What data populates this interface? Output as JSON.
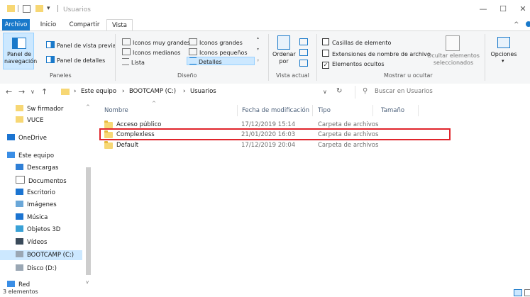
{
  "window": {
    "title": "Usuarios",
    "controls": {
      "minimize": "—",
      "maximize": "☐",
      "close": "✕"
    }
  },
  "ribbon_tabs": {
    "archivo": "Archivo",
    "inicio": "Inicio",
    "compartir": "Compartir",
    "vista": "Vista"
  },
  "ribbon": {
    "panel_navegacion": "Panel de\nnavegación",
    "panel_vista_previa": "Panel de vista previa",
    "panel_detalles": "Panel de detalles",
    "group_paneles": "Paneles",
    "layout": {
      "iconos_muy_grandes": "Iconos muy grandes",
      "iconos_grandes": "Iconos grandes",
      "iconos_medianos": "Iconos medianos",
      "iconos_pequenos": "Iconos pequeños",
      "lista": "Lista",
      "detalles": "Detalles"
    },
    "group_diseno": "Diseño",
    "ordenar": "Ordenar\npor",
    "group_vista_actual": "Vista actual",
    "casillas": "Casillas de elemento",
    "extensiones": "Extensiones de nombre de archivo",
    "ocultos": "Elementos ocultos",
    "ocultar": "Ocultar elementos\nseleccionados",
    "group_mostrar": "Mostrar u ocultar",
    "opciones": "Opciones"
  },
  "address": {
    "path": [
      "Este equipo",
      "BOOTCAMP (C:)",
      "Usuarios"
    ],
    "search_placeholder": "Buscar en Usuarios"
  },
  "sidebar": {
    "items": [
      {
        "label": "Sw firmador",
        "icon": "folder-icon"
      },
      {
        "label": "VUCE",
        "icon": "folder-icon"
      },
      {
        "label": "OneDrive",
        "icon": "cloud-icon"
      },
      {
        "label": "Este equipo",
        "icon": "computer-icon"
      },
      {
        "label": "Descargas",
        "icon": "download-icon"
      },
      {
        "label": "Documentos",
        "icon": "document-icon"
      },
      {
        "label": "Escritorio",
        "icon": "desktop-icon"
      },
      {
        "label": "Imágenes",
        "icon": "image-icon"
      },
      {
        "label": "Música",
        "icon": "music-icon"
      },
      {
        "label": "Objetos 3D",
        "icon": "cube-icon"
      },
      {
        "label": "Vídeos",
        "icon": "video-icon"
      },
      {
        "label": "BOOTCAMP (C:)",
        "icon": "drive-icon"
      },
      {
        "label": "Disco (D:)",
        "icon": "drive-icon"
      },
      {
        "label": "Red",
        "icon": "network-icon"
      }
    ]
  },
  "columns": {
    "nombre": "Nombre",
    "fecha": "Fecha de modificación",
    "tipo": "Tipo",
    "tamano": "Tamaño"
  },
  "files": [
    {
      "name": "Acceso público",
      "date": "17/12/2019 15:14",
      "type": "Carpeta de archivos"
    },
    {
      "name": "Complexless",
      "date": "21/01/2020 16:03",
      "type": "Carpeta de archivos"
    },
    {
      "name": "Default",
      "date": "17/12/2019 20:04",
      "type": "Carpeta de archivos"
    }
  ],
  "status": {
    "count": "3 elementos"
  }
}
